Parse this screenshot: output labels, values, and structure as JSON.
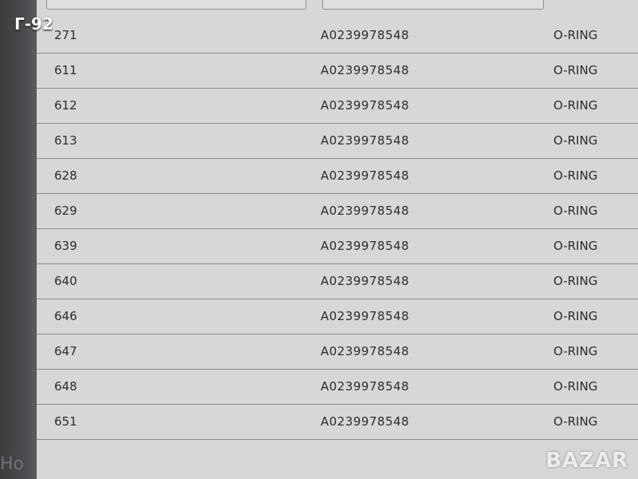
{
  "overlay": {
    "label": "Г-92"
  },
  "table": {
    "rows": [
      {
        "code": "271",
        "part": "A0239978548",
        "desc": "O-RING"
      },
      {
        "code": "611",
        "part": "A0239978548",
        "desc": "O-RING"
      },
      {
        "code": "612",
        "part": "A0239978548",
        "desc": "O-RING"
      },
      {
        "code": "613",
        "part": "A0239978548",
        "desc": "O-RING"
      },
      {
        "code": "628",
        "part": "A0239978548",
        "desc": "O-RING"
      },
      {
        "code": "629",
        "part": "A0239978548",
        "desc": "O-RING"
      },
      {
        "code": "639",
        "part": "A0239978548",
        "desc": "O-RING"
      },
      {
        "code": "640",
        "part": "A0239978548",
        "desc": "O-RING"
      },
      {
        "code": "646",
        "part": "A0239978548",
        "desc": "O-RING"
      },
      {
        "code": "647",
        "part": "A0239978548",
        "desc": "O-RING"
      },
      {
        "code": "648",
        "part": "A0239978548",
        "desc": "O-RING"
      },
      {
        "code": "651",
        "part": "A0239978548",
        "desc": "O-RING"
      }
    ]
  },
  "footer": {
    "left_text": "Ho"
  },
  "watermark": {
    "text": "BAZAR"
  }
}
